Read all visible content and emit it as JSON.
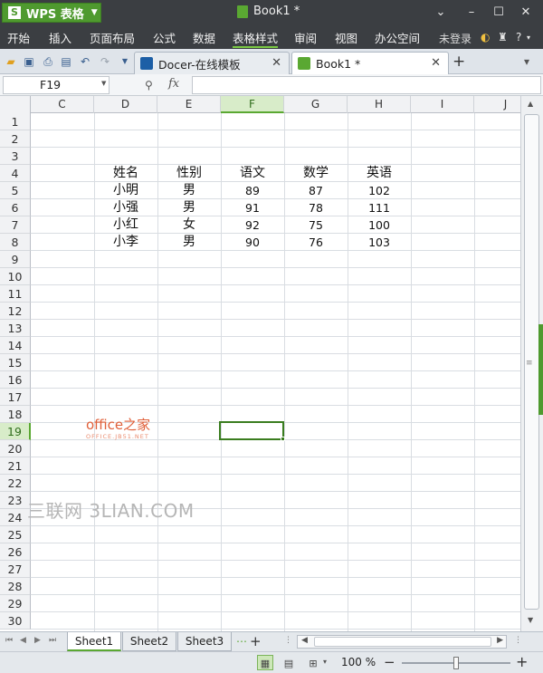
{
  "app": {
    "name": "WPS 表格",
    "logo_mark": "S",
    "document_title": "Book1 *",
    "window_buttons": [
      "chevron-down-icon",
      "minimize-icon",
      "maximize-icon",
      "close-icon"
    ]
  },
  "menu": {
    "items": [
      "开始",
      "插入",
      "页面布局",
      "公式",
      "数据",
      "表格样式",
      "审阅",
      "视图",
      "办公空间"
    ],
    "active": "表格样式",
    "login": "未登录",
    "help": "?"
  },
  "tabs": [
    {
      "label": "Docer-在线模板",
      "icon": "docer-icon",
      "active": false,
      "icon_color": "#1d5fa6"
    },
    {
      "label": "Book1 *",
      "icon": "spreadsheet-icon",
      "active": true,
      "icon_color": "#5aa832"
    }
  ],
  "formula_bar": {
    "name_box": "F19",
    "fx": "fx",
    "formula": ""
  },
  "sheet": {
    "columns": [
      "C",
      "D",
      "E",
      "F",
      "G",
      "H",
      "I",
      "J"
    ],
    "selected_column": "F",
    "rows": [
      "1",
      "2",
      "3",
      "4",
      "5",
      "6",
      "7",
      "8",
      "9",
      "10",
      "11",
      "12",
      "13",
      "14",
      "15",
      "16",
      "17",
      "18",
      "19",
      "20",
      "21",
      "22",
      "23",
      "24",
      "25",
      "26",
      "27",
      "28",
      "29",
      "30"
    ],
    "selected_row": "19",
    "table": {
      "headers": [
        "姓名",
        "性别",
        "语文",
        "数学",
        "英语"
      ],
      "records": [
        [
          "小明",
          "男",
          "89",
          "87",
          "102"
        ],
        [
          "小强",
          "男",
          "91",
          "78",
          "111"
        ],
        [
          "小红",
          "女",
          "92",
          "75",
          "100"
        ],
        [
          "小李",
          "男",
          "90",
          "76",
          "103"
        ]
      ]
    }
  },
  "watermarks": {
    "office": "office之家",
    "office_sub": "OFFICE.JB51.NET",
    "lian": "三联网 3LIAN.COM"
  },
  "sheet_tabs": [
    "Sheet1",
    "Sheet2",
    "Sheet3"
  ],
  "active_sheet": "Sheet1",
  "status": {
    "zoom": "100 %",
    "zoom_fraction": 0.5
  },
  "colors": {
    "accent": "#5aa832",
    "titlebar": "#3b3e42",
    "selection_border": "#3a7d1f"
  }
}
